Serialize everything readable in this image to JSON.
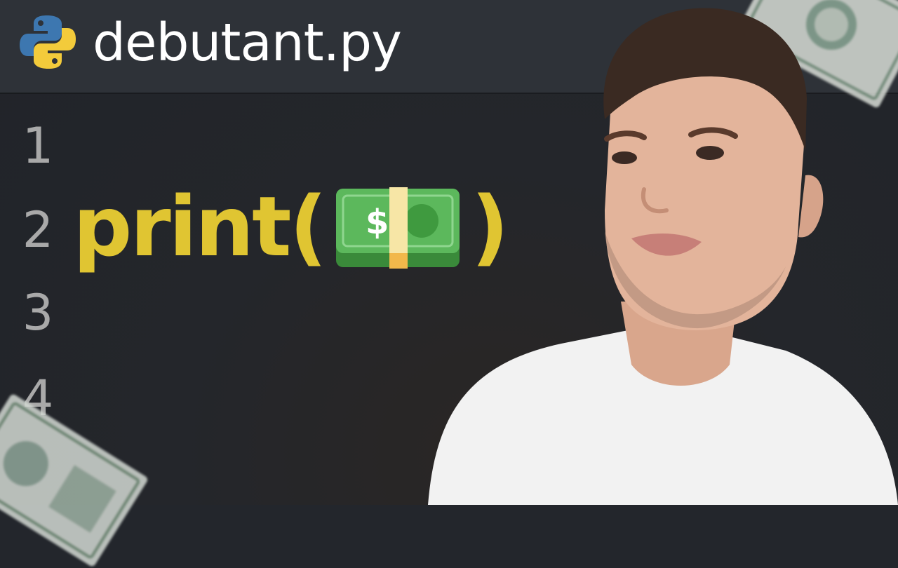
{
  "tab": {
    "filename": "debutant.py",
    "icon": "python-logo-icon"
  },
  "editor": {
    "line_numbers": [
      "1",
      "2",
      "3",
      "4"
    ],
    "code": {
      "function": "print(",
      "argument_icon": "money-bundle-icon",
      "close": ")"
    }
  },
  "colors": {
    "background": "#23262c",
    "tab_bar": "#2e3238",
    "keyword": "#e0c532",
    "line_number": "#a9a9a9",
    "money_green": "#3c9a3c",
    "python_blue": "#3d77b0",
    "python_yellow": "#f3cb3b"
  }
}
